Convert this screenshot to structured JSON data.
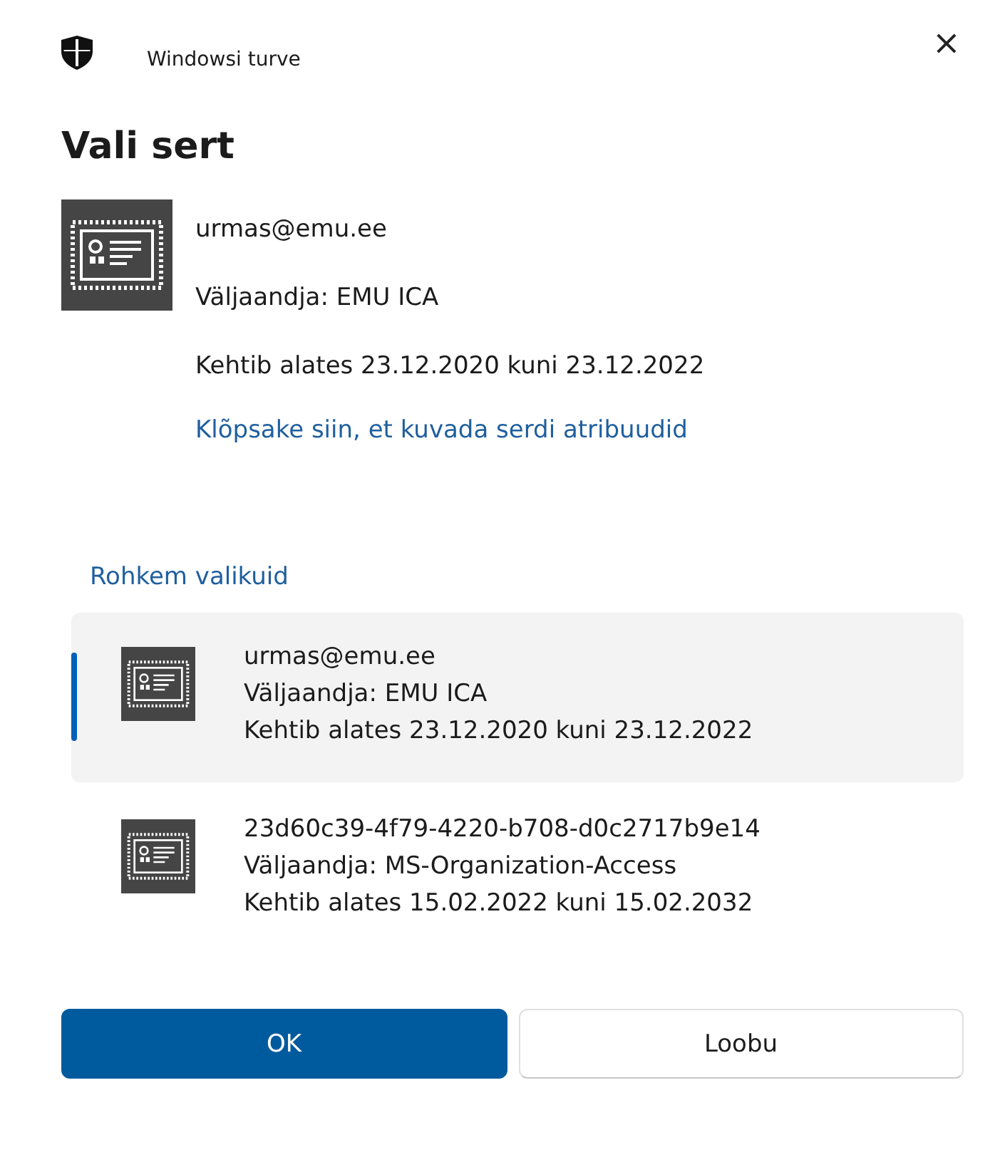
{
  "window": {
    "title": "Windowsi turve",
    "close": "×"
  },
  "heading": "Vali sert",
  "certificate": {
    "subject": "urmas@emu.ee",
    "issuer": "Väljaandja: EMU ICA",
    "validity": "Kehtib alates 23.12.2020 kuni 23.12.2022",
    "link": "Klõpsake siin, et kuvada serdi atribuudid"
  },
  "more_choices": {
    "label": "Rohkem valikuid"
  },
  "choices": [
    {
      "subject": "urmas@emu.ee",
      "issuer": "Väljaandja: EMU ICA",
      "validity": "Kehtib alates 23.12.2020 kuni 23.12.2022",
      "selected": true
    },
    {
      "subject": "23d60c39-4f79-4220-b708-d0c2717b9e14",
      "issuer": "Väljaandja: MS-Organization-Access",
      "validity": "Kehtib alates 15.02.2022 kuni 15.02.2032",
      "selected": false
    }
  ],
  "buttons": [
    {
      "label": "OK",
      "kind": "primary"
    },
    {
      "label": "Loobu",
      "kind": "secondary"
    }
  ]
}
